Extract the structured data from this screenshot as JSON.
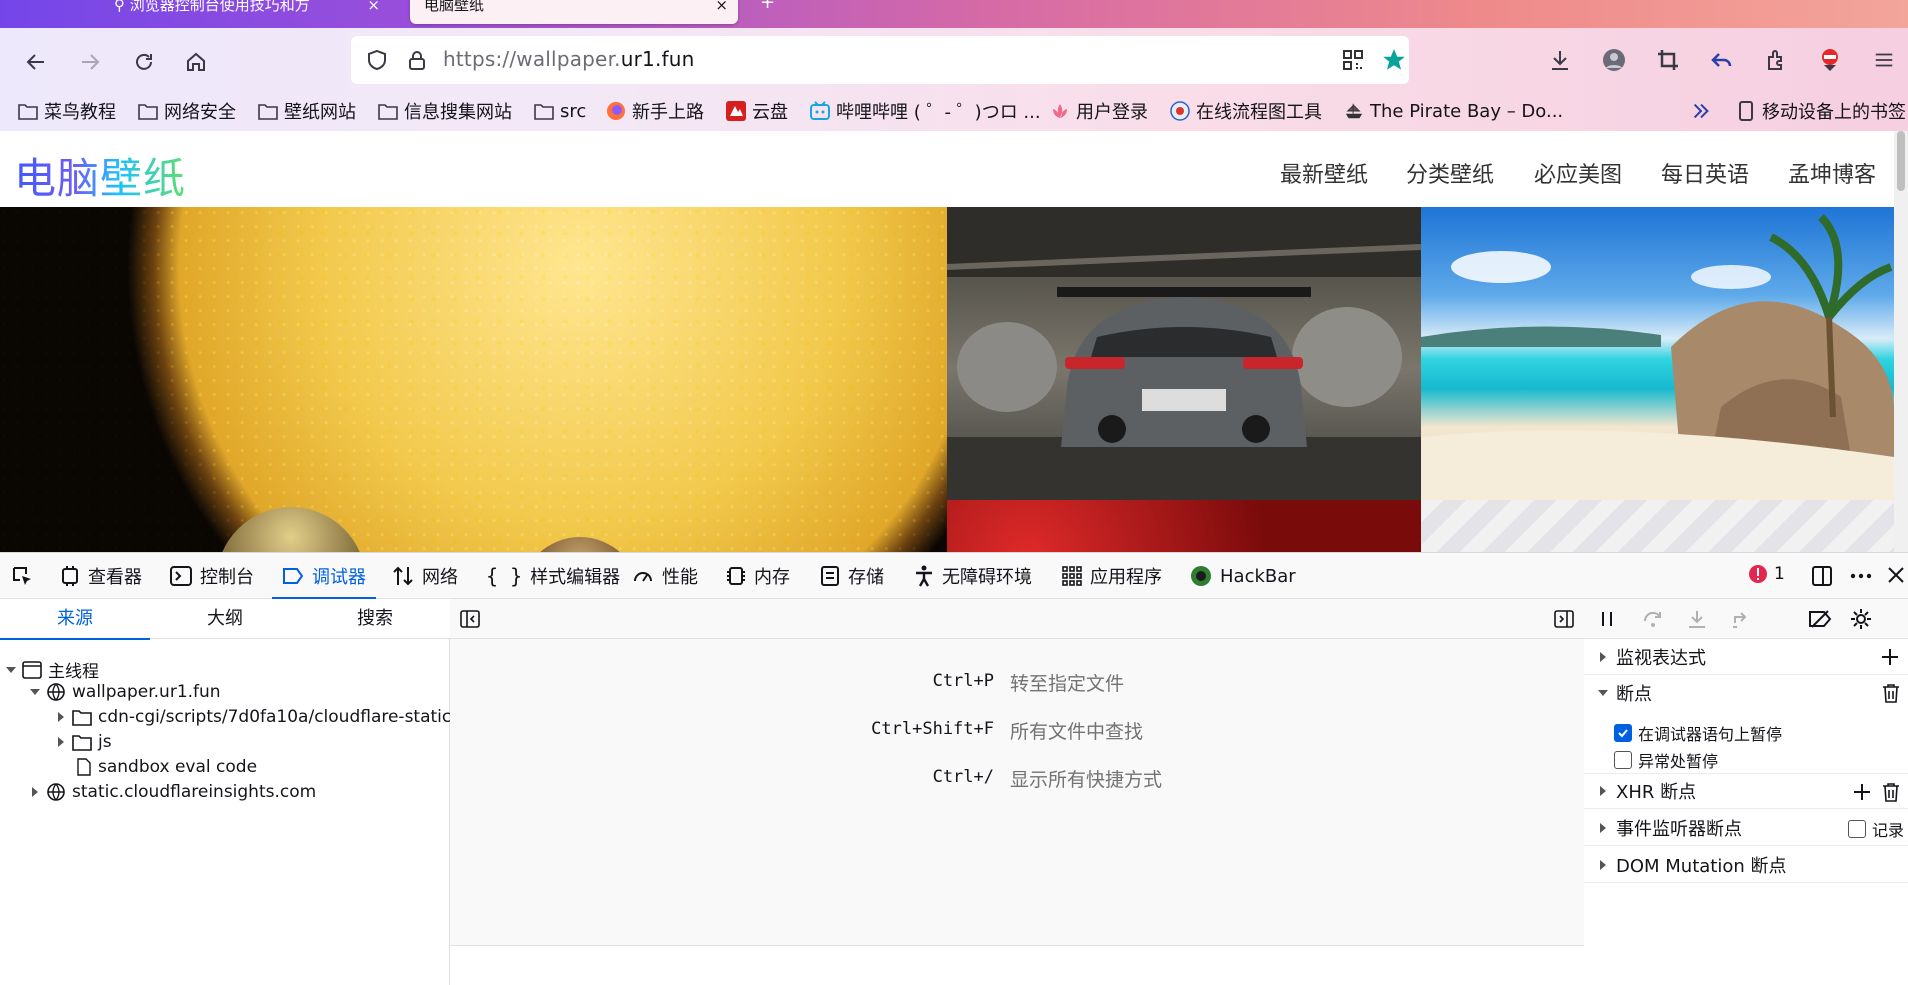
{
  "browser": {
    "tabs": [
      {
        "label": "⚲ 浏览器控制台使用技巧和方",
        "close": "×"
      },
      {
        "label": "电脑壁纸",
        "close": "×"
      }
    ],
    "url": {
      "prefix": "https://wallpaper.",
      "host": "ur1.fun"
    },
    "bookmarks": [
      {
        "label": "菜鸟教程",
        "icon": "folder-icon"
      },
      {
        "label": "网络安全",
        "icon": "folder-icon"
      },
      {
        "label": "壁纸网站",
        "icon": "folder-icon"
      },
      {
        "label": "信息搜集网站",
        "icon": "folder-icon"
      },
      {
        "label": "src",
        "icon": "folder-icon"
      },
      {
        "label": "新手上路",
        "icon": "firefox-icon"
      },
      {
        "label": "云盘",
        "icon": "cloud-drive-icon"
      },
      {
        "label": "哔哩哔哩 ( ゜- ゜)つロ ...",
        "icon": "bilibili-icon"
      },
      {
        "label": "用户登录",
        "icon": "lotus-icon"
      },
      {
        "label": "在线流程图工具",
        "icon": "flowchart-icon"
      },
      {
        "label": "The Pirate Bay – Do...",
        "icon": "pirate-ship-icon"
      }
    ],
    "overflow_label": "移动设备上的书签",
    "accent": "#0061e0"
  },
  "site": {
    "logo": "电脑壁纸",
    "nav": [
      "最新壁纸",
      "分类壁纸",
      "必应美图",
      "每日英语",
      "孟坤博客"
    ]
  },
  "devtools": {
    "tabs": [
      "查看器",
      "控制台",
      "调试器",
      "网络",
      "样式编辑器",
      "性能",
      "内存",
      "存储",
      "无障碍环境",
      "应用程序",
      "HackBar"
    ],
    "selected_tab": "调试器",
    "error_count": "1",
    "left_tabs": [
      "来源",
      "大纲",
      "搜索"
    ],
    "tree": {
      "thread": "主线程",
      "domain": "wallpaper.ur1.fun",
      "folder1": "cdn-cgi/scripts/7d0fa10a/cloudflare-static",
      "folder2": "js",
      "file": "sandbox eval code",
      "domain2": "static.cloudflareinsights.com"
    },
    "shortcuts": [
      {
        "key": "Ctrl+P",
        "desc": "转至指定文件"
      },
      {
        "key": "Ctrl+Shift+F",
        "desc": "所有文件中查找"
      },
      {
        "key": "Ctrl+/",
        "desc": "显示所有快捷方式"
      }
    ],
    "right": {
      "watch": "监视表达式",
      "breakpoints": "断点",
      "pause_debugger": "在调试器语句上暂停",
      "pause_exceptions": "异常处暂停",
      "xhr": "XHR 断点",
      "events": "事件监听器断点",
      "log": "记录",
      "dom": "DOM Mutation 断点"
    }
  }
}
